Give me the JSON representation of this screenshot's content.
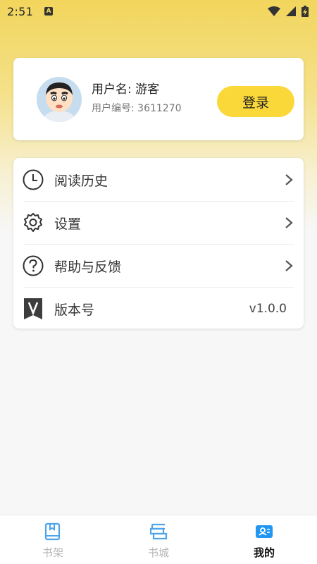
{
  "status_bar": {
    "time": "2:51",
    "indicator": "A"
  },
  "profile": {
    "username": "用户名: 游客",
    "user_id": "用户编号: 3611270",
    "login_label": "登录",
    "avatar_icon": "cartoon-boy-avatar"
  },
  "menu": {
    "items": [
      {
        "label": "阅读历史",
        "icon": "clock-icon"
      },
      {
        "label": "设置",
        "icon": "gear-icon"
      },
      {
        "label": "帮助与反馈",
        "icon": "question-icon"
      },
      {
        "label": "版本号",
        "icon": "version-v-icon",
        "value": "v1.0.0"
      }
    ]
  },
  "bottom_nav": {
    "items": [
      {
        "label": "书架",
        "icon": "bookshelf-icon",
        "active": false
      },
      {
        "label": "书城",
        "icon": "bookstore-icon",
        "active": false
      },
      {
        "label": "我的",
        "icon": "profile-icon",
        "active": true
      }
    ]
  },
  "colors": {
    "accent": "#fbd83a",
    "header_gradient_top": "#f2d55c",
    "nav_active_icon": "#2196f3",
    "nav_inactive_icon": "#4fa3e8"
  }
}
